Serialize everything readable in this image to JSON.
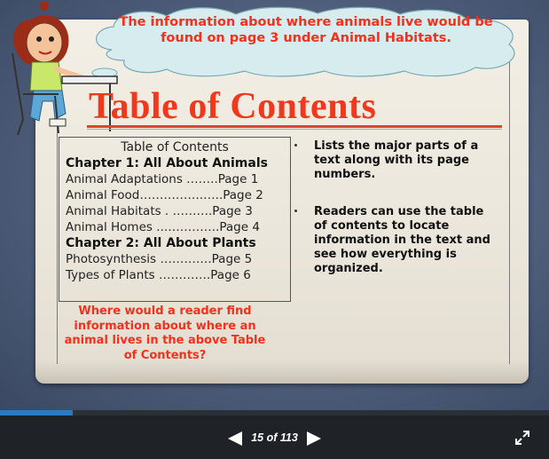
{
  "slide": {
    "cloud_text": "The information about where animals live would be found on page 3 under Animal Habitats.",
    "title": "Table of Contents",
    "toc": {
      "heading": "Table of Contents",
      "chapter1": "Chapter 1:  All About Animals",
      "chapter1_items": [
        "Animal Adaptations ……..Page 1",
        "Animal Food…………….…..Page 2",
        "Animal Habitats  . ……….Page 3",
        "Animal Homes ..…………..Page 4"
      ],
      "chapter2": "Chapter 2:  All About Plants",
      "chapter2_items": [
        "Photosynthesis ………….Page 5",
        "Types of Plants ………….Page 6"
      ]
    },
    "note1": "Lists the major parts of a text along with its page numbers.",
    "note2": "Readers can use the table of contents to locate information in the text and see how everything is organized.",
    "question": "Where would a reader find information about where an animal lives in the above Table of Contents?"
  },
  "player": {
    "page_indicator": "15 of 113",
    "progress": 0.133,
    "accent": "#2a7bc6",
    "icons": [
      "prev-arrow-icon",
      "next-arrow-icon",
      "fullscreen-icon"
    ]
  }
}
